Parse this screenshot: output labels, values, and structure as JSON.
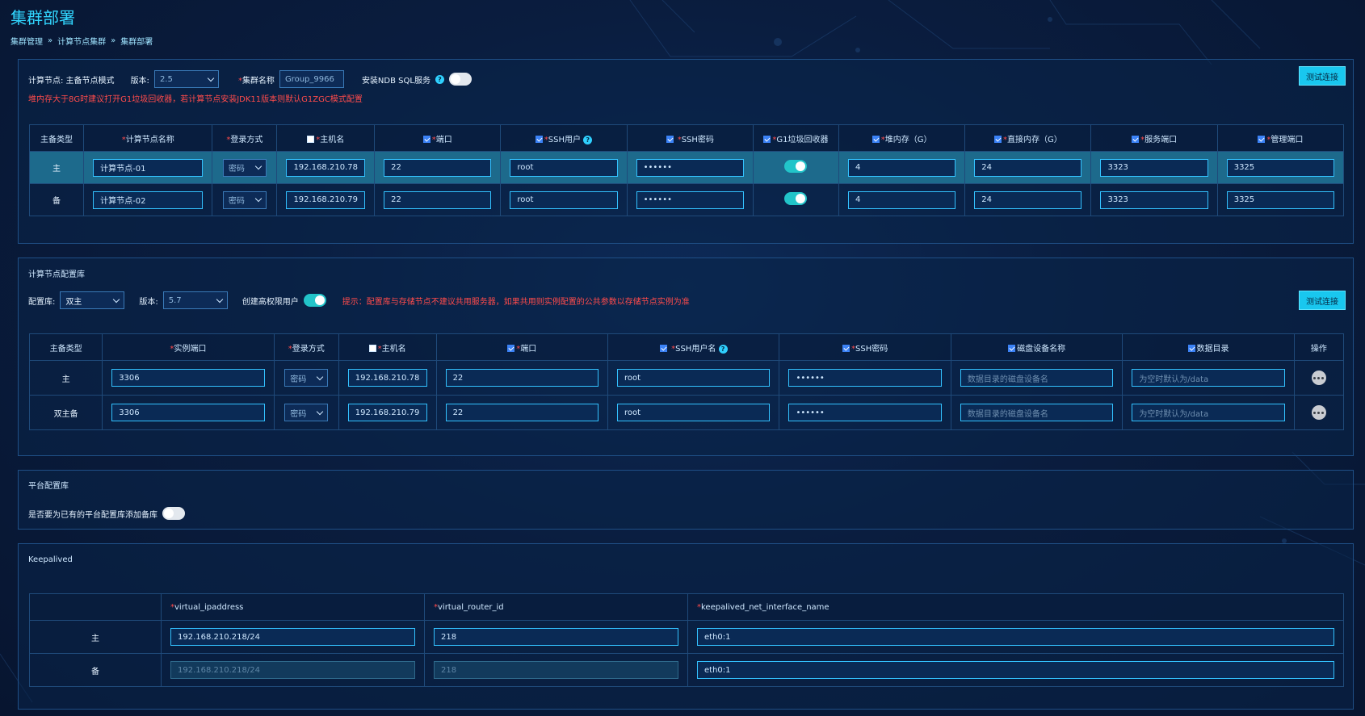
{
  "page": {
    "title": "集群部署",
    "breadcrumb": [
      "集群管理",
      "计算节点集群",
      "集群部署"
    ]
  },
  "compute_panel": {
    "mode_label": "计算节点: 主备节点模式",
    "version_label": "版本:",
    "version_value": "2.5",
    "cluster_name_label": "集群名称",
    "cluster_name_placeholder": "Group_9966",
    "ndb_label": "安装NDB SQL服务",
    "warning": "堆内存大于8G时建议打开G1垃圾回收器，若计算节点安装JDK11版本则默认G1ZGC模式配置",
    "test_button": "测试连接",
    "columns": [
      "主备类型",
      "计算节点名称",
      "登录方式",
      "主机名",
      "端口",
      "SSH用户",
      "SSH密码",
      "G1垃圾回收器",
      "堆内存（G）",
      "直接内存（G）",
      "服务端口",
      "管理端口"
    ],
    "rows": [
      {
        "type": "主",
        "name": "计算节点-01",
        "login": "密码",
        "host": "192.168.210.78",
        "port": "22",
        "ssh_user": "root",
        "ssh_pwd": "••••••",
        "heap": "4",
        "direct": "24",
        "service_port": "3323",
        "manage_port": "3325"
      },
      {
        "type": "备",
        "name": "计算节点-02",
        "login": "密码",
        "host": "192.168.210.79",
        "port": "22",
        "ssh_user": "root",
        "ssh_pwd": "••••••",
        "heap": "4",
        "direct": "24",
        "service_port": "3323",
        "manage_port": "3325"
      }
    ]
  },
  "config_panel": {
    "title": "计算节点配置库",
    "config_label": "配置库:",
    "config_value": "双主",
    "version_label": "版本:",
    "version_value": "5.7",
    "create_user_label": "创建高权限用户",
    "hint": "提示：配置库与存储节点不建议共用服务器，如果共用则实例配置的公共参数以存储节点实例为准",
    "test_button": "测试连接",
    "columns": [
      "主备类型",
      "实例端口",
      "登录方式",
      "主机名",
      "端口",
      "SSH用户名",
      "SSH密码",
      "磁盘设备名称",
      "数据目录",
      "操作"
    ],
    "disk_placeholder": "数据目录的磁盘设备名",
    "dir_placeholder": "为空时默认为/data",
    "rows": [
      {
        "type": "主",
        "port": "3306",
        "login": "密码",
        "host": "192.168.210.78",
        "ssh_port": "22",
        "ssh_user": "root",
        "ssh_pwd": "••••••"
      },
      {
        "type": "双主备",
        "port": "3306",
        "login": "密码",
        "host": "192.168.210.79",
        "ssh_port": "22",
        "ssh_user": "root",
        "ssh_pwd": "••••••"
      }
    ]
  },
  "platform_panel": {
    "title": "平台配置库",
    "question": "是否要为已有的平台配置库添加备库"
  },
  "keepalived_panel": {
    "title": "Keepalived",
    "columns": [
      "virtual_ipaddress",
      "virtual_router_id",
      "keepalived_net_interface_name"
    ],
    "rows": [
      {
        "type": "主",
        "vip": "192.168.210.218/24",
        "router_id": "218",
        "iface": "eth0:1"
      },
      {
        "type": "备",
        "vip": "192.168.210.218/24",
        "router_id": "218",
        "iface": "eth0:1"
      }
    ]
  },
  "colors": {
    "accent": "#19c7ef",
    "warning": "#ff4b4b",
    "toggle_on": "#22c4c9"
  }
}
